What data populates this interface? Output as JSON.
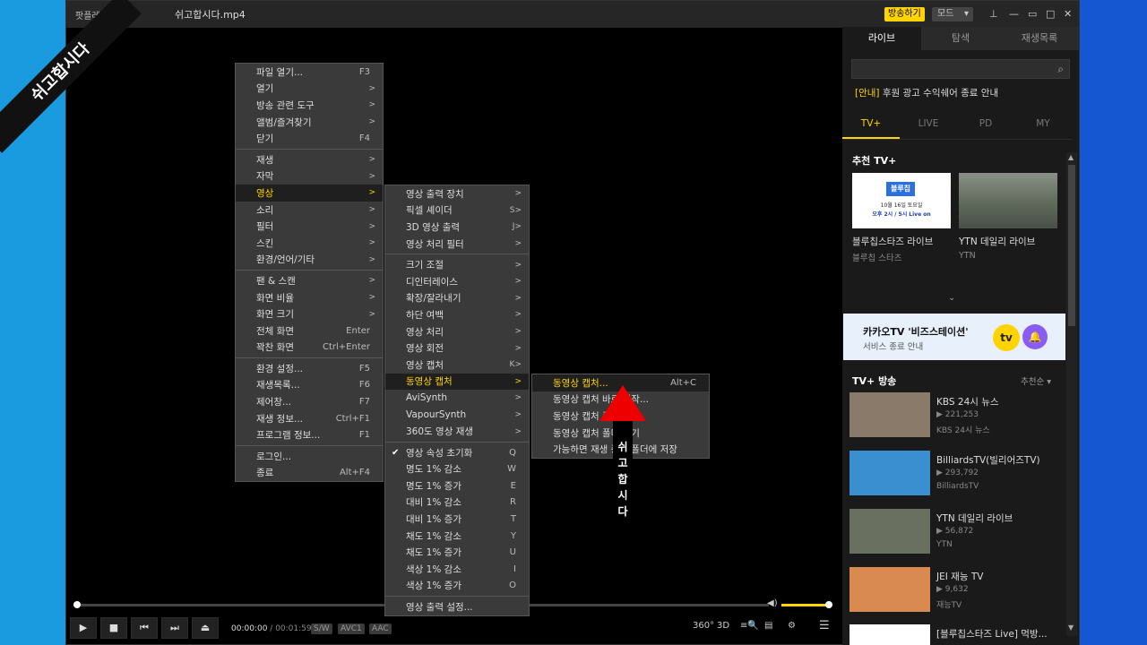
{
  "ribbon": {
    "text": "쉬고합시다"
  },
  "titlebar": {
    "app_name": "팟플레이어",
    "file_title": "쉬고합시다.mp4",
    "broadcast_label": "방송하기",
    "mode_label": "모드"
  },
  "main_menu": [
    {
      "label": "파일 열기...",
      "shortcut": "F3"
    },
    {
      "label": "열기",
      "arrow": ">"
    },
    {
      "label": "방송 관련 도구",
      "arrow": ">"
    },
    {
      "label": "앨범/즐겨찾기",
      "arrow": ">"
    },
    {
      "label": "닫기",
      "shortcut": "F4"
    },
    {
      "label": "재생",
      "arrow": ">"
    },
    {
      "label": "자막",
      "arrow": ">"
    },
    {
      "label": "영상",
      "arrow": ">"
    },
    {
      "label": "소리",
      "arrow": ">"
    },
    {
      "label": "필터",
      "arrow": ">"
    },
    {
      "label": "스킨",
      "arrow": ">"
    },
    {
      "label": "환경/언어/기타",
      "arrow": ">"
    },
    {
      "label": "팬 & 스캔",
      "arrow": ">"
    },
    {
      "label": "화면 비율",
      "arrow": ">"
    },
    {
      "label": "화면 크기",
      "arrow": ">"
    },
    {
      "label": "전체 화면",
      "shortcut": "Enter"
    },
    {
      "label": "꽉찬 화면",
      "shortcut": "Ctrl+Enter"
    },
    {
      "label": "환경 설정...",
      "shortcut": "F5"
    },
    {
      "label": "재생목록...",
      "shortcut": "F6"
    },
    {
      "label": "제어창...",
      "shortcut": "F7"
    },
    {
      "label": "재생 정보...",
      "shortcut": "Ctrl+F1"
    },
    {
      "label": "프로그램 정보...",
      "shortcut": "F1"
    },
    {
      "label": "로그인..."
    },
    {
      "label": "종료",
      "shortcut": "Alt+F4"
    }
  ],
  "video_menu": [
    {
      "label": "영상 출력 장치",
      "arrow": ">"
    },
    {
      "label": "픽셀 셰이더",
      "arrow": "S>"
    },
    {
      "label": "3D 영상 출력",
      "arrow": "J>"
    },
    {
      "label": "영상 처리 필터",
      "arrow": ">"
    },
    {
      "label": "크기 조절",
      "arrow": ">"
    },
    {
      "label": "디인터레이스",
      "arrow": ">"
    },
    {
      "label": "확장/잘라내기",
      "arrow": ">"
    },
    {
      "label": "하단 여백",
      "arrow": ">"
    },
    {
      "label": "영상 처리",
      "arrow": ">"
    },
    {
      "label": "영상 회전",
      "arrow": ">"
    },
    {
      "label": "영상 캡처",
      "arrow": "K>"
    },
    {
      "label": "동영상 캡처",
      "arrow": ">"
    },
    {
      "label": "AviSynth",
      "arrow": ">"
    },
    {
      "label": "VapourSynth",
      "arrow": ">"
    },
    {
      "label": "360도 영상 재생",
      "arrow": ">"
    },
    {
      "label": "영상 속성 초기화",
      "shortcut": "Q"
    },
    {
      "label": "명도 1% 감소",
      "shortcut": "W"
    },
    {
      "label": "명도 1% 증가",
      "shortcut": "E"
    },
    {
      "label": "대비 1% 감소",
      "shortcut": "R"
    },
    {
      "label": "대비 1% 증가",
      "shortcut": "T"
    },
    {
      "label": "채도 1% 감소",
      "shortcut": "Y"
    },
    {
      "label": "채도 1% 증가",
      "shortcut": "U"
    },
    {
      "label": "색상 1% 감소",
      "shortcut": "I"
    },
    {
      "label": "색상 1% 증가",
      "shortcut": "O"
    },
    {
      "label": "영상 출력 설정..."
    }
  ],
  "capture_menu": [
    {
      "label": "동영상 캡처...",
      "shortcut": "Alt+C"
    },
    {
      "label": "동영상 캡처 바로 시작..."
    },
    {
      "label": "동영상 캡처 중지"
    },
    {
      "label": "동영상 캡처 폴더 열기"
    },
    {
      "label": "가능하면 재생 중인 폴더에 저장"
    }
  ],
  "annotation": {
    "chars": [
      "쉬",
      "고",
      "합",
      "시",
      "다"
    ]
  },
  "controls": {
    "time_current": "00:00:00",
    "time_total": "/ 00:01:59",
    "codec_sw": "S/W",
    "codec_video": "AVC1",
    "codec_audio": "AAC",
    "btn_360": "360°",
    "btn_3d": "3D"
  },
  "panel": {
    "tabs": [
      "라이브",
      "탐색",
      "재생목록"
    ],
    "notice_tag": "[안내]",
    "notice_text": " 후원 광고 수익쉐어 종료 안내",
    "subtabs": [
      "TV+",
      "LIVE",
      "PD",
      "MY"
    ],
    "rec_title": "추천 TV+",
    "rec": [
      {
        "name": "블루칩스타즈 라이브",
        "sub": "블루칩 스타즈",
        "thumb_line1": "블루칩",
        "thumb_line2": "10월 16일 토요일",
        "thumb_line3": "오후 2시 / 5시 Live on"
      },
      {
        "name": "YTN 데일리 라이브",
        "sub": "YTN"
      }
    ],
    "banner_title": "카카오TV '비즈스테이션'",
    "banner_sub": "서비스 종료 안내",
    "banner_logo": "tv",
    "broadcast_title": "TV+ 방송",
    "sort_label": "추천순 ▾",
    "channels": [
      {
        "name": "KBS 24시 뉴스",
        "views": "▶ 221,253",
        "sub": "KBS 24시 뉴스",
        "thumb": "#8a7a6a"
      },
      {
        "name": "BilliardsTV(빌리어즈TV)",
        "views": "▶ 293,792",
        "sub": "BilliardsTV",
        "thumb": "#3a8fd0"
      },
      {
        "name": "YTN 데일리 라이브",
        "views": "▶ 56,872",
        "sub": "YTN",
        "thumb": "#6a7060"
      },
      {
        "name": "JEI 재능 TV",
        "views": "▶ 9,632",
        "sub": "재능TV",
        "thumb": "#d88a50"
      },
      {
        "name": "[블루칩스타즈 Live] 먹방...",
        "views": "",
        "sub": "",
        "thumb": "#ffffff"
      }
    ]
  },
  "colors": {
    "accent": "#ffd400",
    "arrow": "#e00000",
    "left_bg": "#1a9be0",
    "right_bg": "#1557d0"
  }
}
